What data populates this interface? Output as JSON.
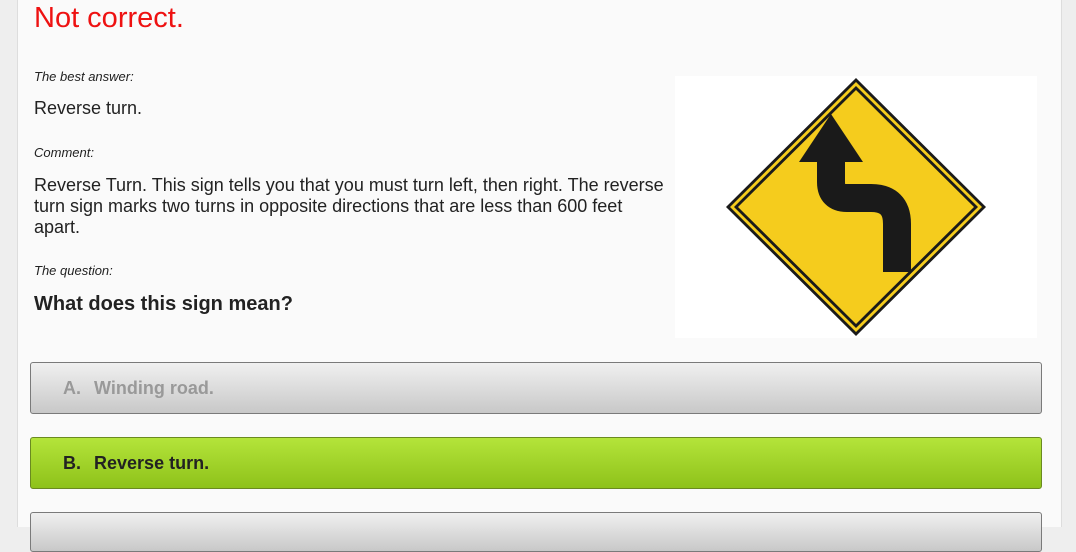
{
  "result": {
    "title": "Not correct."
  },
  "best_answer": {
    "label": "The best answer:",
    "text": "Reverse turn."
  },
  "comment": {
    "label": "Comment:",
    "text": "Reverse Turn. This sign tells you that you must turn left, then right. The reverse turn sign marks two turns in opposite directions that are less than 600 feet apart."
  },
  "question": {
    "label": "The question:",
    "text": "What does this sign mean?"
  },
  "sign": {
    "icon": "reverse-turn-sign-icon",
    "fill_color": "#f5cc1d",
    "border_color": "#1a1a1a"
  },
  "options": [
    {
      "letter": "A.",
      "text": "Winding road.",
      "state": "incorrect"
    },
    {
      "letter": "B.",
      "text": "Reverse turn.",
      "state": "correct"
    }
  ],
  "colors": {
    "error": "#ee1111",
    "correct": "#9ad025"
  }
}
